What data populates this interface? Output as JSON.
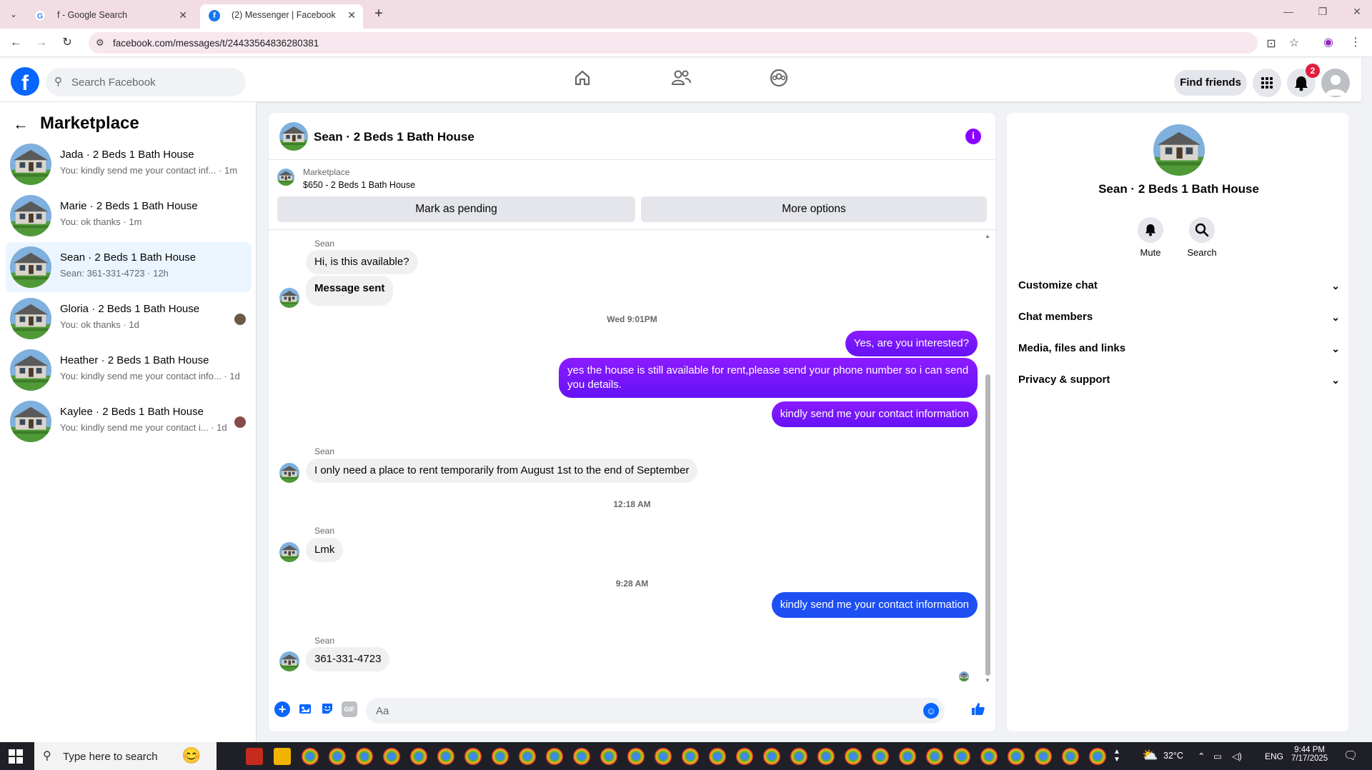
{
  "browser": {
    "tabs": [
      {
        "title": "f - Google Search"
      },
      {
        "title": "(2) Messenger | Facebook"
      }
    ],
    "url": "facebook.com/messages/t/24433564836280381"
  },
  "header": {
    "search_placeholder": "Search Facebook",
    "find_friends_label": "Find friends",
    "notification_count": "2"
  },
  "sidebar": {
    "title": "Marketplace",
    "conversations": [
      {
        "name": "Jada · 2 Beds 1 Bath House",
        "preview": "You: kindly send me your contact inf... · 1m"
      },
      {
        "name": "Marie · 2 Beds 1 Bath House",
        "preview": "You: ok thanks · 1m"
      },
      {
        "name": "Sean · 2 Beds 1 Bath House",
        "preview": "Sean: 361-331-4723 · 12h"
      },
      {
        "name": "Gloria · 2 Beds 1 Bath House",
        "preview": "You: ok thanks · 1d"
      },
      {
        "name": "Heather · 2 Beds 1 Bath House",
        "preview": "You: kindly send me your contact info... · 1d"
      },
      {
        "name": "Kaylee · 2 Beds 1 Bath House",
        "preview": "You: kindly send me your contact i... · 1d"
      }
    ]
  },
  "chat": {
    "title": "Sean · 2 Beds 1 Bath House",
    "listing": {
      "source": "Marketplace",
      "price_title": "$650 - 2 Beds 1 Bath House",
      "mark_pending_label": "Mark as pending",
      "more_options_label": "More options"
    },
    "messages": {
      "sender_name": "Sean",
      "m1": "Hi, is this available?",
      "m2": "Message sent",
      "ts1": "Wed 9:01PM",
      "m3": "Yes, are you interested?",
      "m4": "yes the house is still available for rent,please send your phone number so i can send you details.",
      "m5": "kindly send me your contact information",
      "m6": "I only need a place to rent temporarily from August 1st to the end of September",
      "ts2": "12:18 AM",
      "m7": "Lmk",
      "ts3": "9:28 AM",
      "m8": "kindly send me your contact information",
      "m9": "361-331-4723"
    },
    "composer_placeholder": "Aa",
    "gif_label": "GIF"
  },
  "right_panel": {
    "name": "Sean · 2 Beds 1 Bath House",
    "mute_label": "Mute",
    "search_label": "Search",
    "sections": [
      "Customize chat",
      "Chat members",
      "Media, files and links",
      "Privacy & support"
    ]
  },
  "taskbar": {
    "search_placeholder": "Type here to search",
    "temperature": "32°C",
    "language": "ENG",
    "time": "9:44 PM",
    "date": "7/17/2025"
  },
  "colors": {
    "facebook_blue": "#0866ff",
    "outgoing_purple": "#7a17fa",
    "outgoing_blue": "#1d4ff3",
    "active_conversation": "#ebf5ff"
  }
}
